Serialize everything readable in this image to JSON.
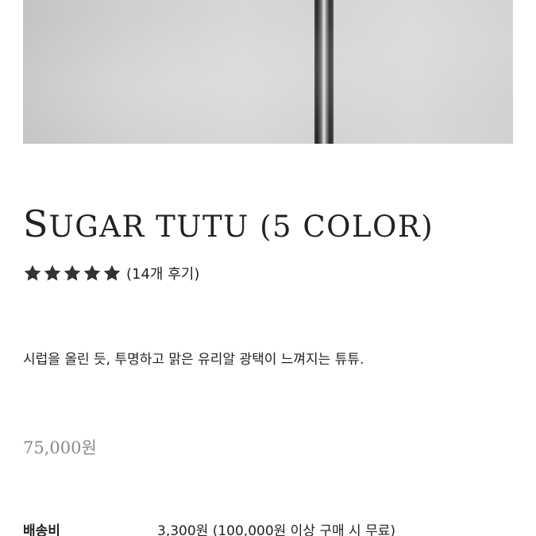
{
  "product": {
    "title_first": "S",
    "title_rest": "UGAR TUTU (5 COLOR)",
    "rating": {
      "stars_filled": 5,
      "stars_total": 5,
      "review_count_label": "(14개 후기)"
    },
    "description": "시럽을 올린 듯, 투명하고 맑은 유리알 광택이 느껴지는 튜튜.",
    "price": "75,000원",
    "shipping": {
      "label": "배송비",
      "value": "3,300원 (100,000원 이상 구매 시 무료)"
    }
  },
  "colors": {
    "text": "#222222",
    "price": "#8a8a8a",
    "star": "#333333"
  },
  "icons": {
    "star": "star-icon"
  }
}
